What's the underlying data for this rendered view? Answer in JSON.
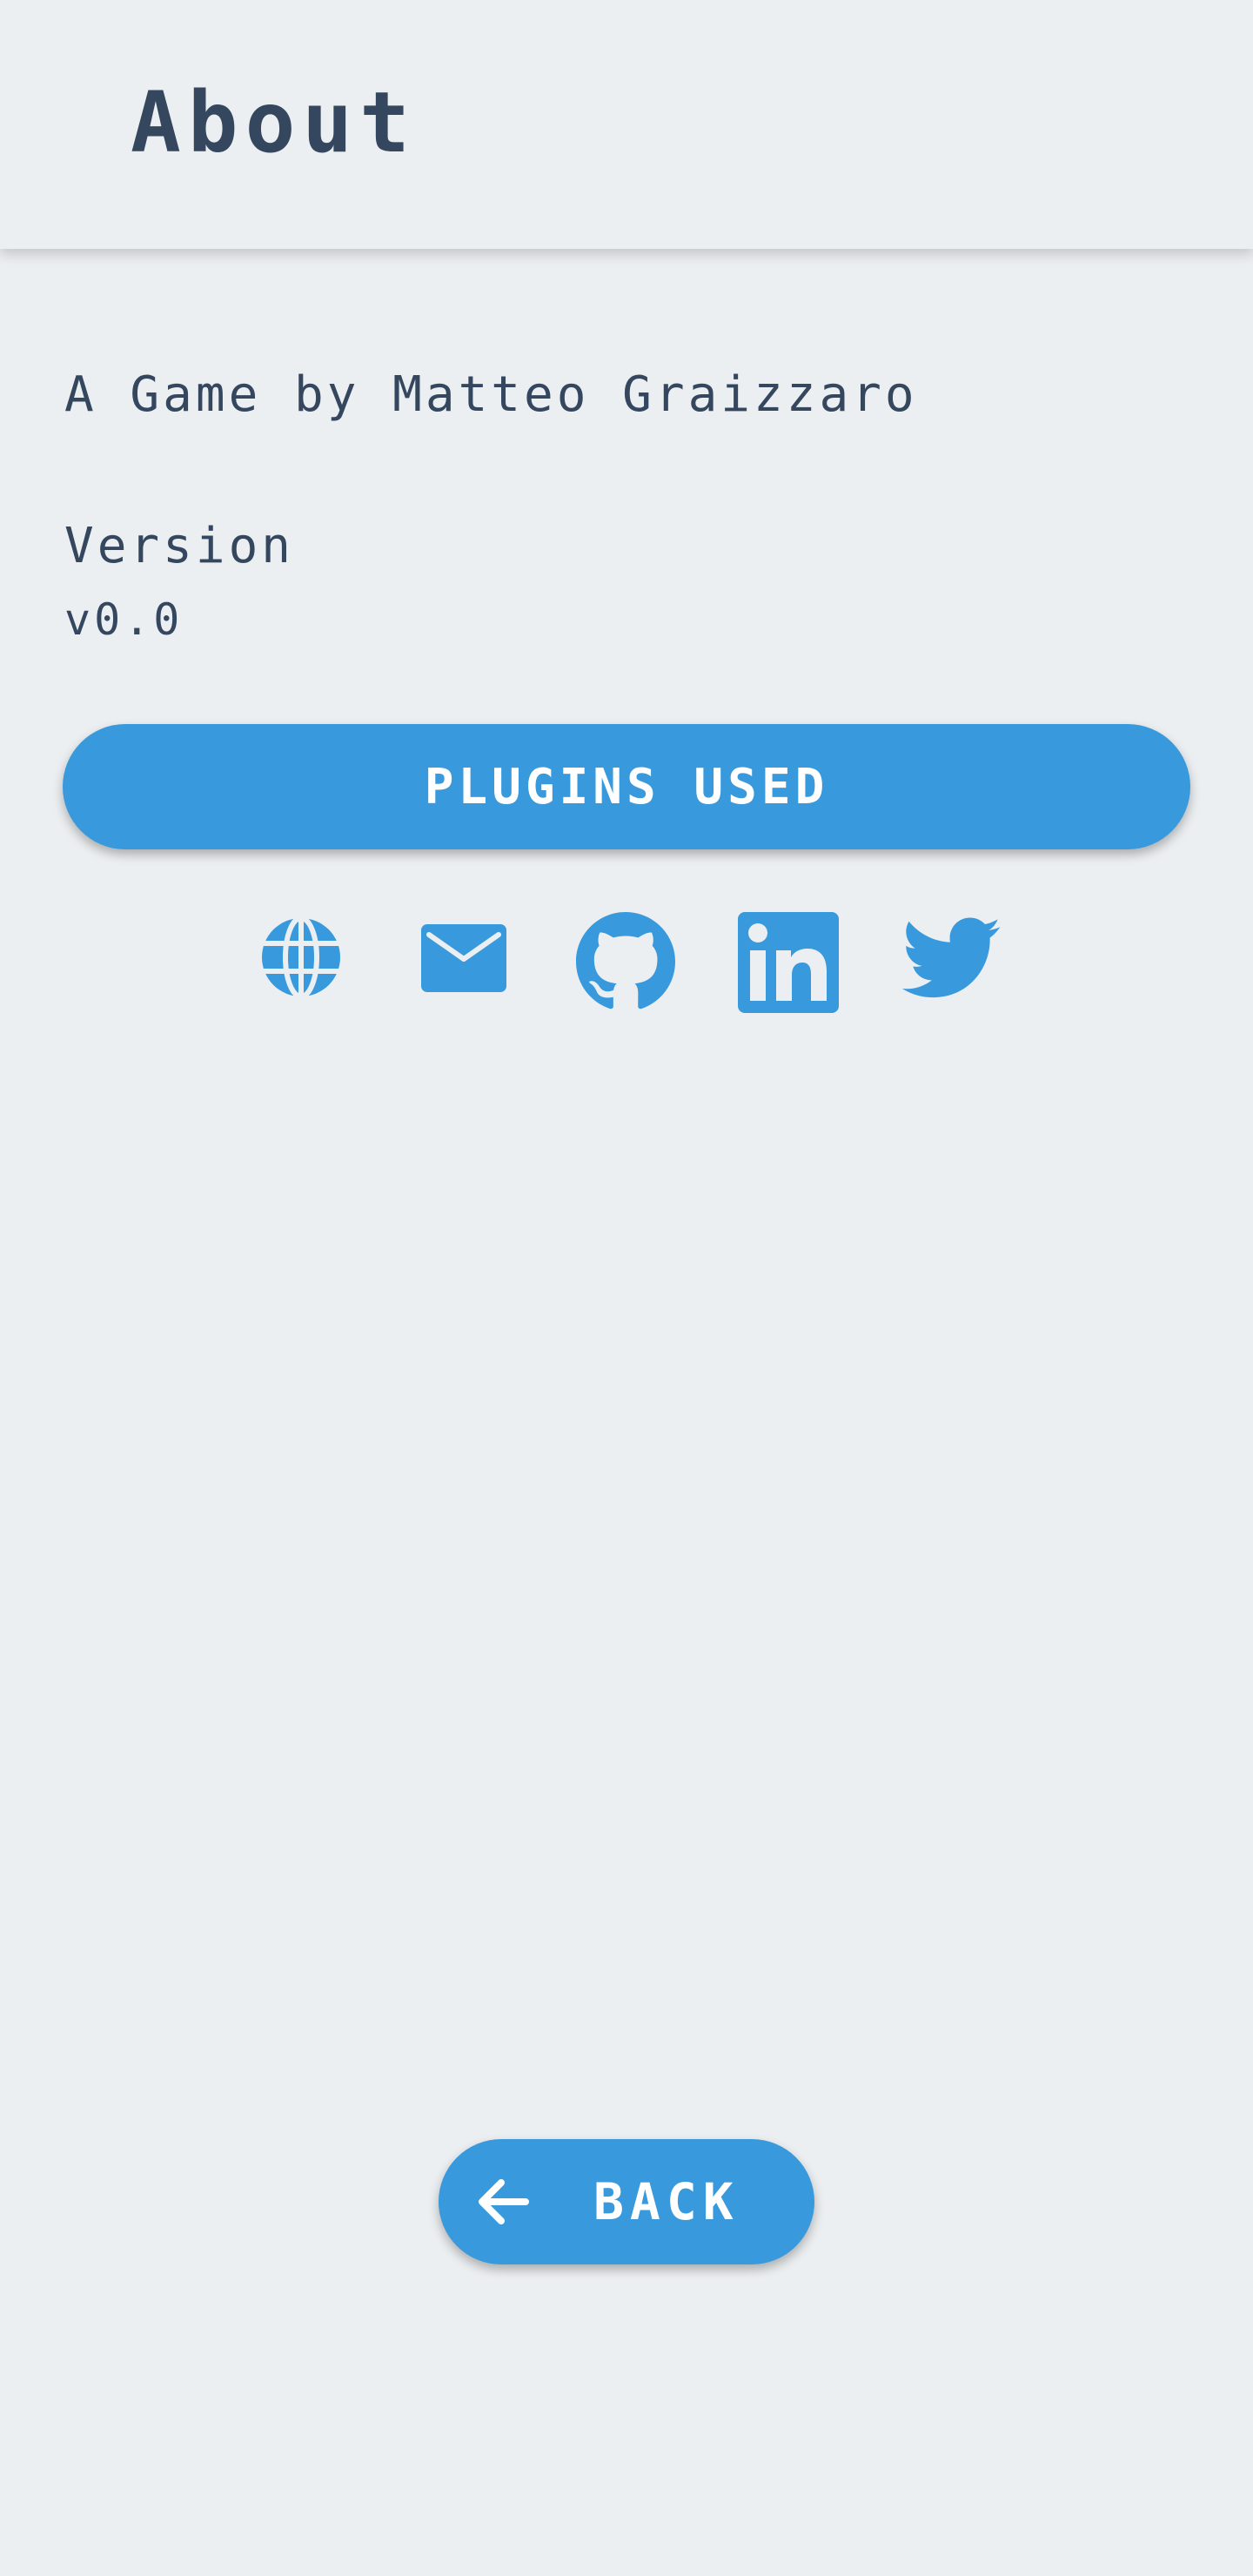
{
  "header": {
    "title": "About"
  },
  "main": {
    "author_text": "A Game by Matteo Graizzaro",
    "version_label": "Version",
    "version_value": "v0.0",
    "plugins_button_label": "PLUGINS USED"
  },
  "social_icons": [
    "globe-icon",
    "mail-icon",
    "github-icon",
    "linkedin-icon",
    "twitter-icon"
  ],
  "footer": {
    "back_button_label": "BACK",
    "back_icon": "arrow-left-icon"
  },
  "colors": {
    "background": "#ECEFF1",
    "accent": "#3899DC",
    "text": "#34475E",
    "button_text": "#FFFFFF"
  }
}
